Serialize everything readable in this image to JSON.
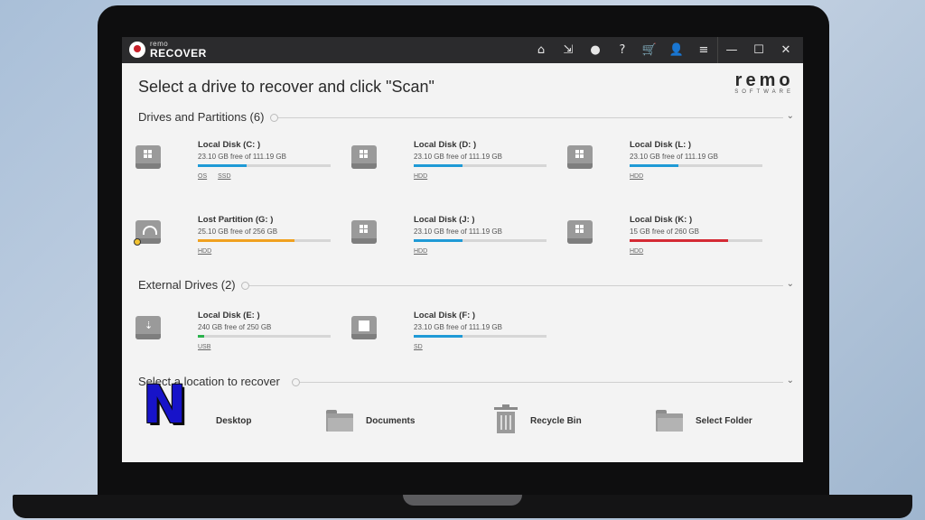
{
  "app": {
    "logo_top": "remo",
    "logo_main": "RECOVER",
    "brand": "remo",
    "brand_sub": "SOFTWARE",
    "title_icons": [
      "home-icon",
      "export-icon",
      "record-icon",
      "help-icon",
      "cart-icon",
      "user-icon",
      "menu-icon",
      "minimize-icon",
      "maximize-icon",
      "close-icon"
    ],
    "title_glyphs": [
      "⌂",
      "⇲",
      "●",
      "?",
      "🛒",
      "👤",
      "≡",
      "—",
      "☐",
      "✕"
    ]
  },
  "main": {
    "heading": "Select a drive to recover and click \"Scan\""
  },
  "sections": {
    "drives": "Drives and Partitions (6)",
    "external": "External Drives (2)",
    "location": "Select a location to recover"
  },
  "drives": [
    {
      "name": "Local Disk (C: )",
      "free": "23.10 GB free of 111.19 GB",
      "fill": 0.37,
      "color": "#1f9ad6",
      "tags": [
        "OS",
        "SSD"
      ],
      "icon": "windows-drive-icon"
    },
    {
      "name": "Local Disk (D: )",
      "free": "23.10 GB free of 111.19 GB",
      "fill": 0.37,
      "color": "#1f9ad6",
      "tags": [
        "HDD"
      ],
      "icon": "windows-drive-icon"
    },
    {
      "name": "Local Disk (L: )",
      "free": "23.10 GB free of 111.19 GB",
      "fill": 0.37,
      "color": "#1f9ad6",
      "tags": [
        "HDD"
      ],
      "icon": "windows-drive-icon"
    },
    {
      "name": "Lost Partition (G: )",
      "free": "25.10 GB free of 256 GB",
      "fill": 0.73,
      "color": "#f0a11f",
      "tags": [
        "HDD"
      ],
      "icon": "lost-partition-icon"
    },
    {
      "name": "Local Disk (J: )",
      "free": "23.10 GB free of 111.19 GB",
      "fill": 0.37,
      "color": "#1f9ad6",
      "tags": [
        "HDD"
      ],
      "icon": "windows-drive-icon"
    },
    {
      "name": "Local Disk (K: )",
      "free": "15 GB free of 260 GB",
      "fill": 0.74,
      "color": "#d42a34",
      "tags": [
        "HDD"
      ],
      "icon": "windows-drive-icon"
    }
  ],
  "external_drives": [
    {
      "name": "Local Disk (E: )",
      "free": "240 GB free of 250 GB",
      "fill": 0.05,
      "color": "#2bb24c",
      "tags": [
        "USB"
      ],
      "icon": "usb-drive-icon"
    },
    {
      "name": "Local Disk (F: )",
      "free": "23.10 GB free of 111.19 GB",
      "fill": 0.37,
      "color": "#1f9ad6",
      "tags": [
        "SD"
      ],
      "icon": "sd-card-icon"
    }
  ],
  "locations": [
    {
      "label": "Desktop",
      "icon": "desktop-folder-icon"
    },
    {
      "label": "Documents",
      "icon": "documents-folder-icon"
    },
    {
      "label": "Recycle Bin",
      "icon": "recycle-bin-icon"
    },
    {
      "label": "Select Folder",
      "icon": "select-folder-icon"
    }
  ],
  "overlay": {
    "glyph": "N",
    "color": "#1713c9"
  }
}
